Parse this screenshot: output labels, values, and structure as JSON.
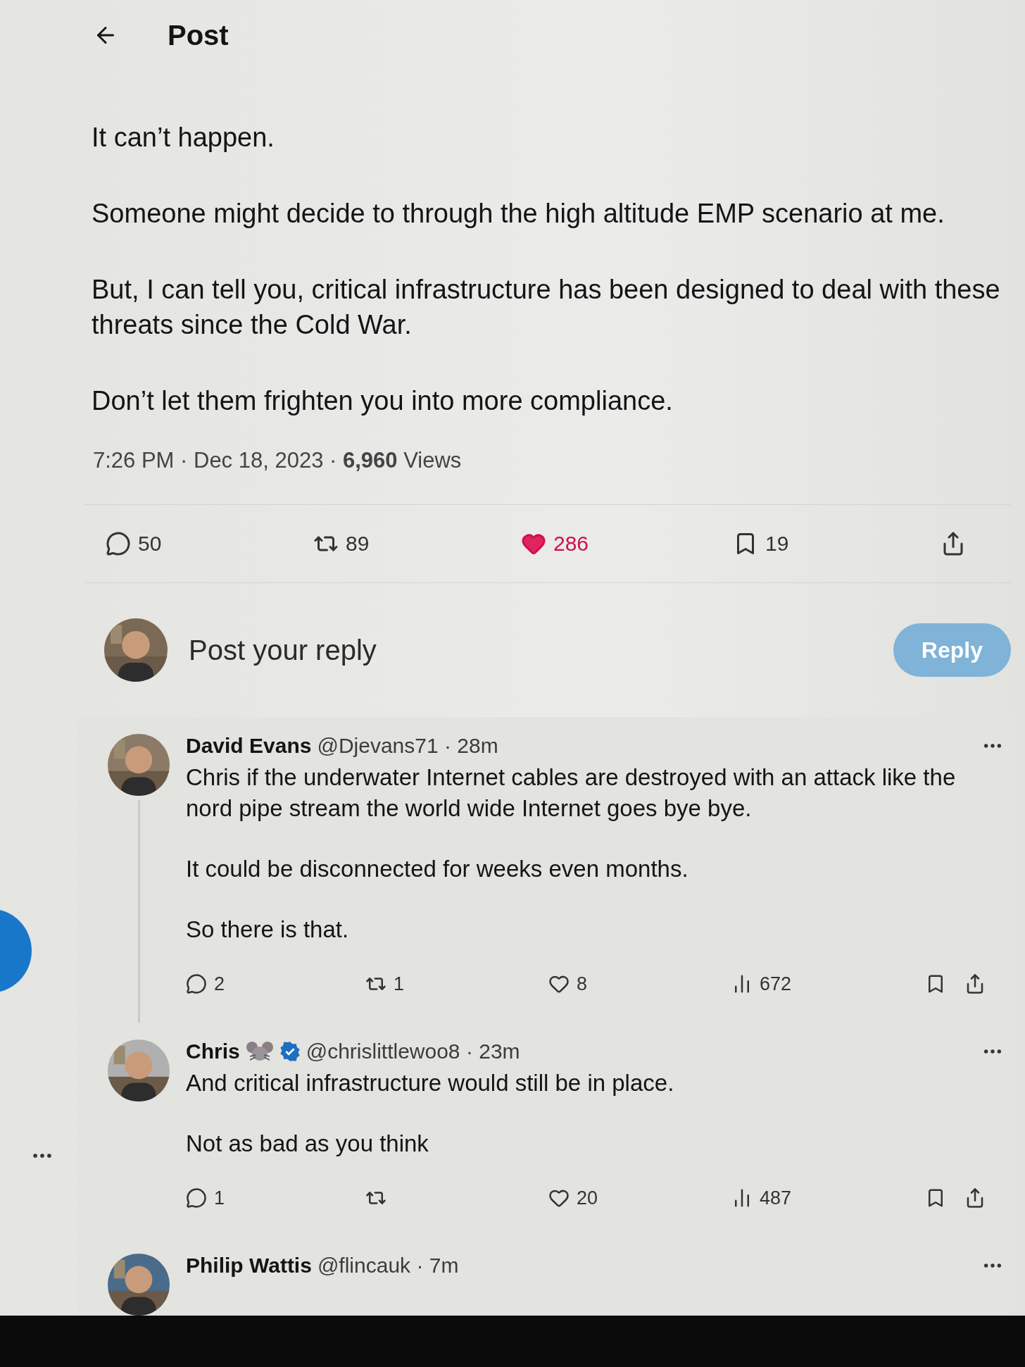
{
  "header": {
    "title": "Post"
  },
  "post": {
    "paragraphs": [
      "It can’t happen.",
      "Someone might decide to through the high altitude EMP scenario at me.",
      "But, I can tell you, critical infrastructure has been designed to deal with these threats since the Cold War.",
      "Don’t let them frighten you into more compliance."
    ],
    "meta": "7:26 PM · Dec 18, 2023 · **6,960** Views",
    "actions": [
      {
        "kind": "reply",
        "count": "50"
      },
      {
        "kind": "repost",
        "count": "89"
      },
      {
        "kind": "like",
        "count": "286",
        "active": true
      },
      {
        "kind": "bookmark",
        "count": "19"
      },
      {
        "kind": "share"
      }
    ]
  },
  "composer": {
    "placeholder": "Post your reply",
    "button": "Reply",
    "disabled": true
  },
  "replies": [
    {
      "name": "David Evans",
      "byline": "@Djevans71 · 28m",
      "verified": false,
      "thread_line": true,
      "paragraphs": [
        "Chris if the underwater Internet cables are destroyed with an attack like the nord pipe stream the world wide Internet goes bye bye.",
        "It could be disconnected for weeks even months.",
        "So there is that."
      ],
      "actions": [
        {
          "kind": "reply",
          "count": "2"
        },
        {
          "kind": "repost",
          "count": "1"
        },
        {
          "kind": "like",
          "count": "8",
          "active": false
        },
        {
          "kind": "views",
          "count": "672"
        },
        {
          "kind": "bookmark"
        },
        {
          "kind": "share"
        }
      ]
    },
    {
      "name": "Chris",
      "byline": "@chrislittlewoo8 · 23m",
      "verified": true,
      "thread_line": false,
      "paragraphs": [
        "And critical infrastructure would still be in place.",
        "Not as bad as you think"
      ],
      "actions": [
        {
          "kind": "reply",
          "count": "1"
        },
        {
          "kind": "repost"
        },
        {
          "kind": "like",
          "count": "20",
          "active": false
        },
        {
          "kind": "views",
          "count": "487"
        },
        {
          "kind": "bookmark"
        },
        {
          "kind": "share"
        }
      ]
    },
    {
      "name": "Philip Wattis",
      "byline": "@flincauk · 7m",
      "verified": false,
      "thread_line": false
    }
  ]
}
